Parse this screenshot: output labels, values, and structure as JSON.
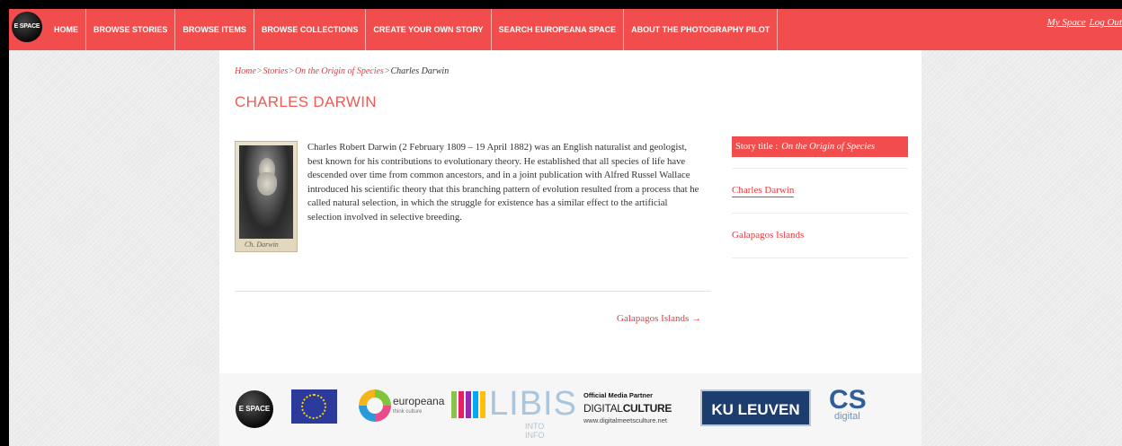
{
  "nav": {
    "logo_text": "E SPACE",
    "items": [
      {
        "label": "HOME"
      },
      {
        "label": "BROWSE STORIES"
      },
      {
        "label": "BROWSE ITEMS"
      },
      {
        "label": "BROWSE COLLECTIONS"
      },
      {
        "label": "CREATE YOUR OWN STORY"
      },
      {
        "label": "SEARCH EUROPEANA SPACE"
      },
      {
        "label": "ABOUT THE PHOTOGRAPHY PILOT"
      }
    ],
    "my_space": "My Space",
    "log_out": "Log Out"
  },
  "breadcrumb": {
    "home": "Home",
    "stories": "Stories",
    "story": "On the Origin of Species",
    "current": "Charles Darwin",
    "sep": ">"
  },
  "page": {
    "title": "CHARLES DARWIN",
    "body": "Charles Robert Darwin (2 February 1809 – 19 April 1882) was an English naturalist and geologist, best known for his contributions to evolutionary theory. He established that all species of life have descended over time from common ancestors, and in a joint publication with Alfred Russel Wallace introduced his scientific theory that this branching pattern of evolution resulted from a process that he called natural selection, in which the struggle for existence has a similar effect to the artificial selection involved in selective breeding.",
    "portrait_signature": "Ch. Darwin",
    "next_link": "Galapagos Islands →"
  },
  "sidebar": {
    "story_label": "Story title :",
    "story_value": "On the Origin of Species",
    "items": [
      {
        "label": "Charles Darwin"
      },
      {
        "label": "Galapagos Islands"
      }
    ]
  },
  "footer": {
    "espace_text": "E SPACE",
    "europeana": "europeana",
    "europeana_sub": "think culture",
    "libis": "LIBIS",
    "libis_sub": "INTO INFO",
    "dmc_title": "Official Media Partner",
    "dmc_digital": "DIGITAL",
    "dmc_culture": "CULTURE",
    "dmc_url": "www.digitalmeetsculture.net",
    "ku": "KU LEUVEN",
    "cs": "CS",
    "cs_sub": "digital"
  },
  "colors": {
    "accent": "#f24d4d",
    "link": "#e8393f",
    "title": "#f05a55"
  }
}
